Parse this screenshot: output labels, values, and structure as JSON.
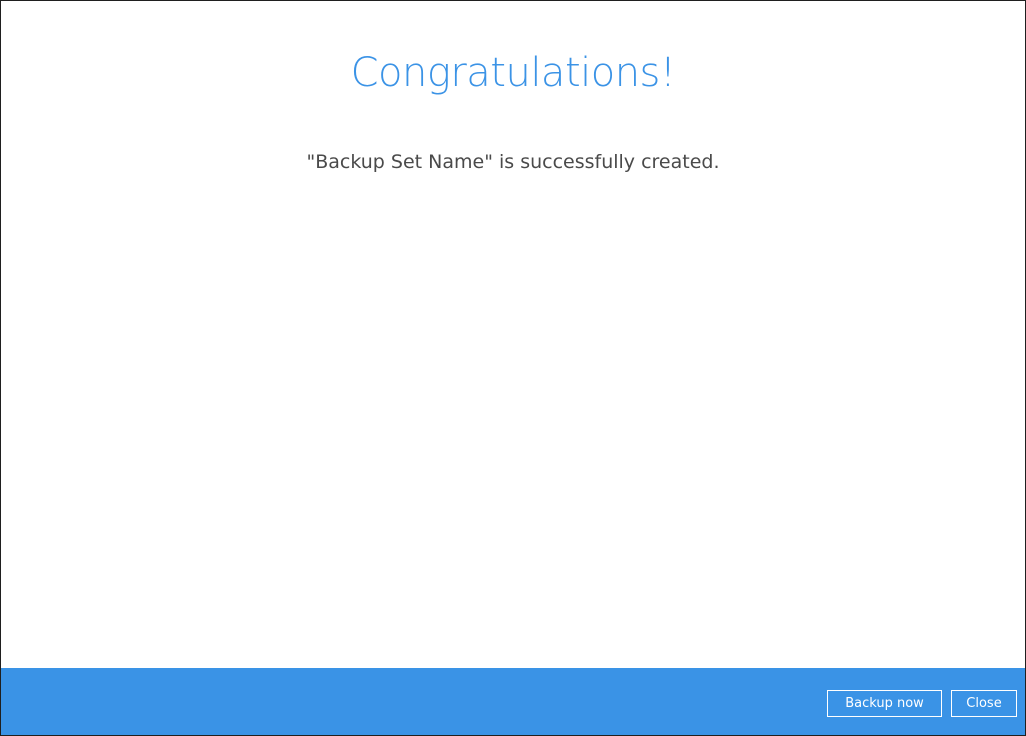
{
  "dialog": {
    "title": "Congratulations!",
    "message": "\"Backup Set Name\" is successfully created."
  },
  "footer": {
    "backup_now_label": "Backup now",
    "close_label": "Close"
  },
  "colors": {
    "accent": "#3a93e6",
    "title_text": "#3b93e6",
    "body_text": "#4a4a4a",
    "background": "#ffffff"
  }
}
